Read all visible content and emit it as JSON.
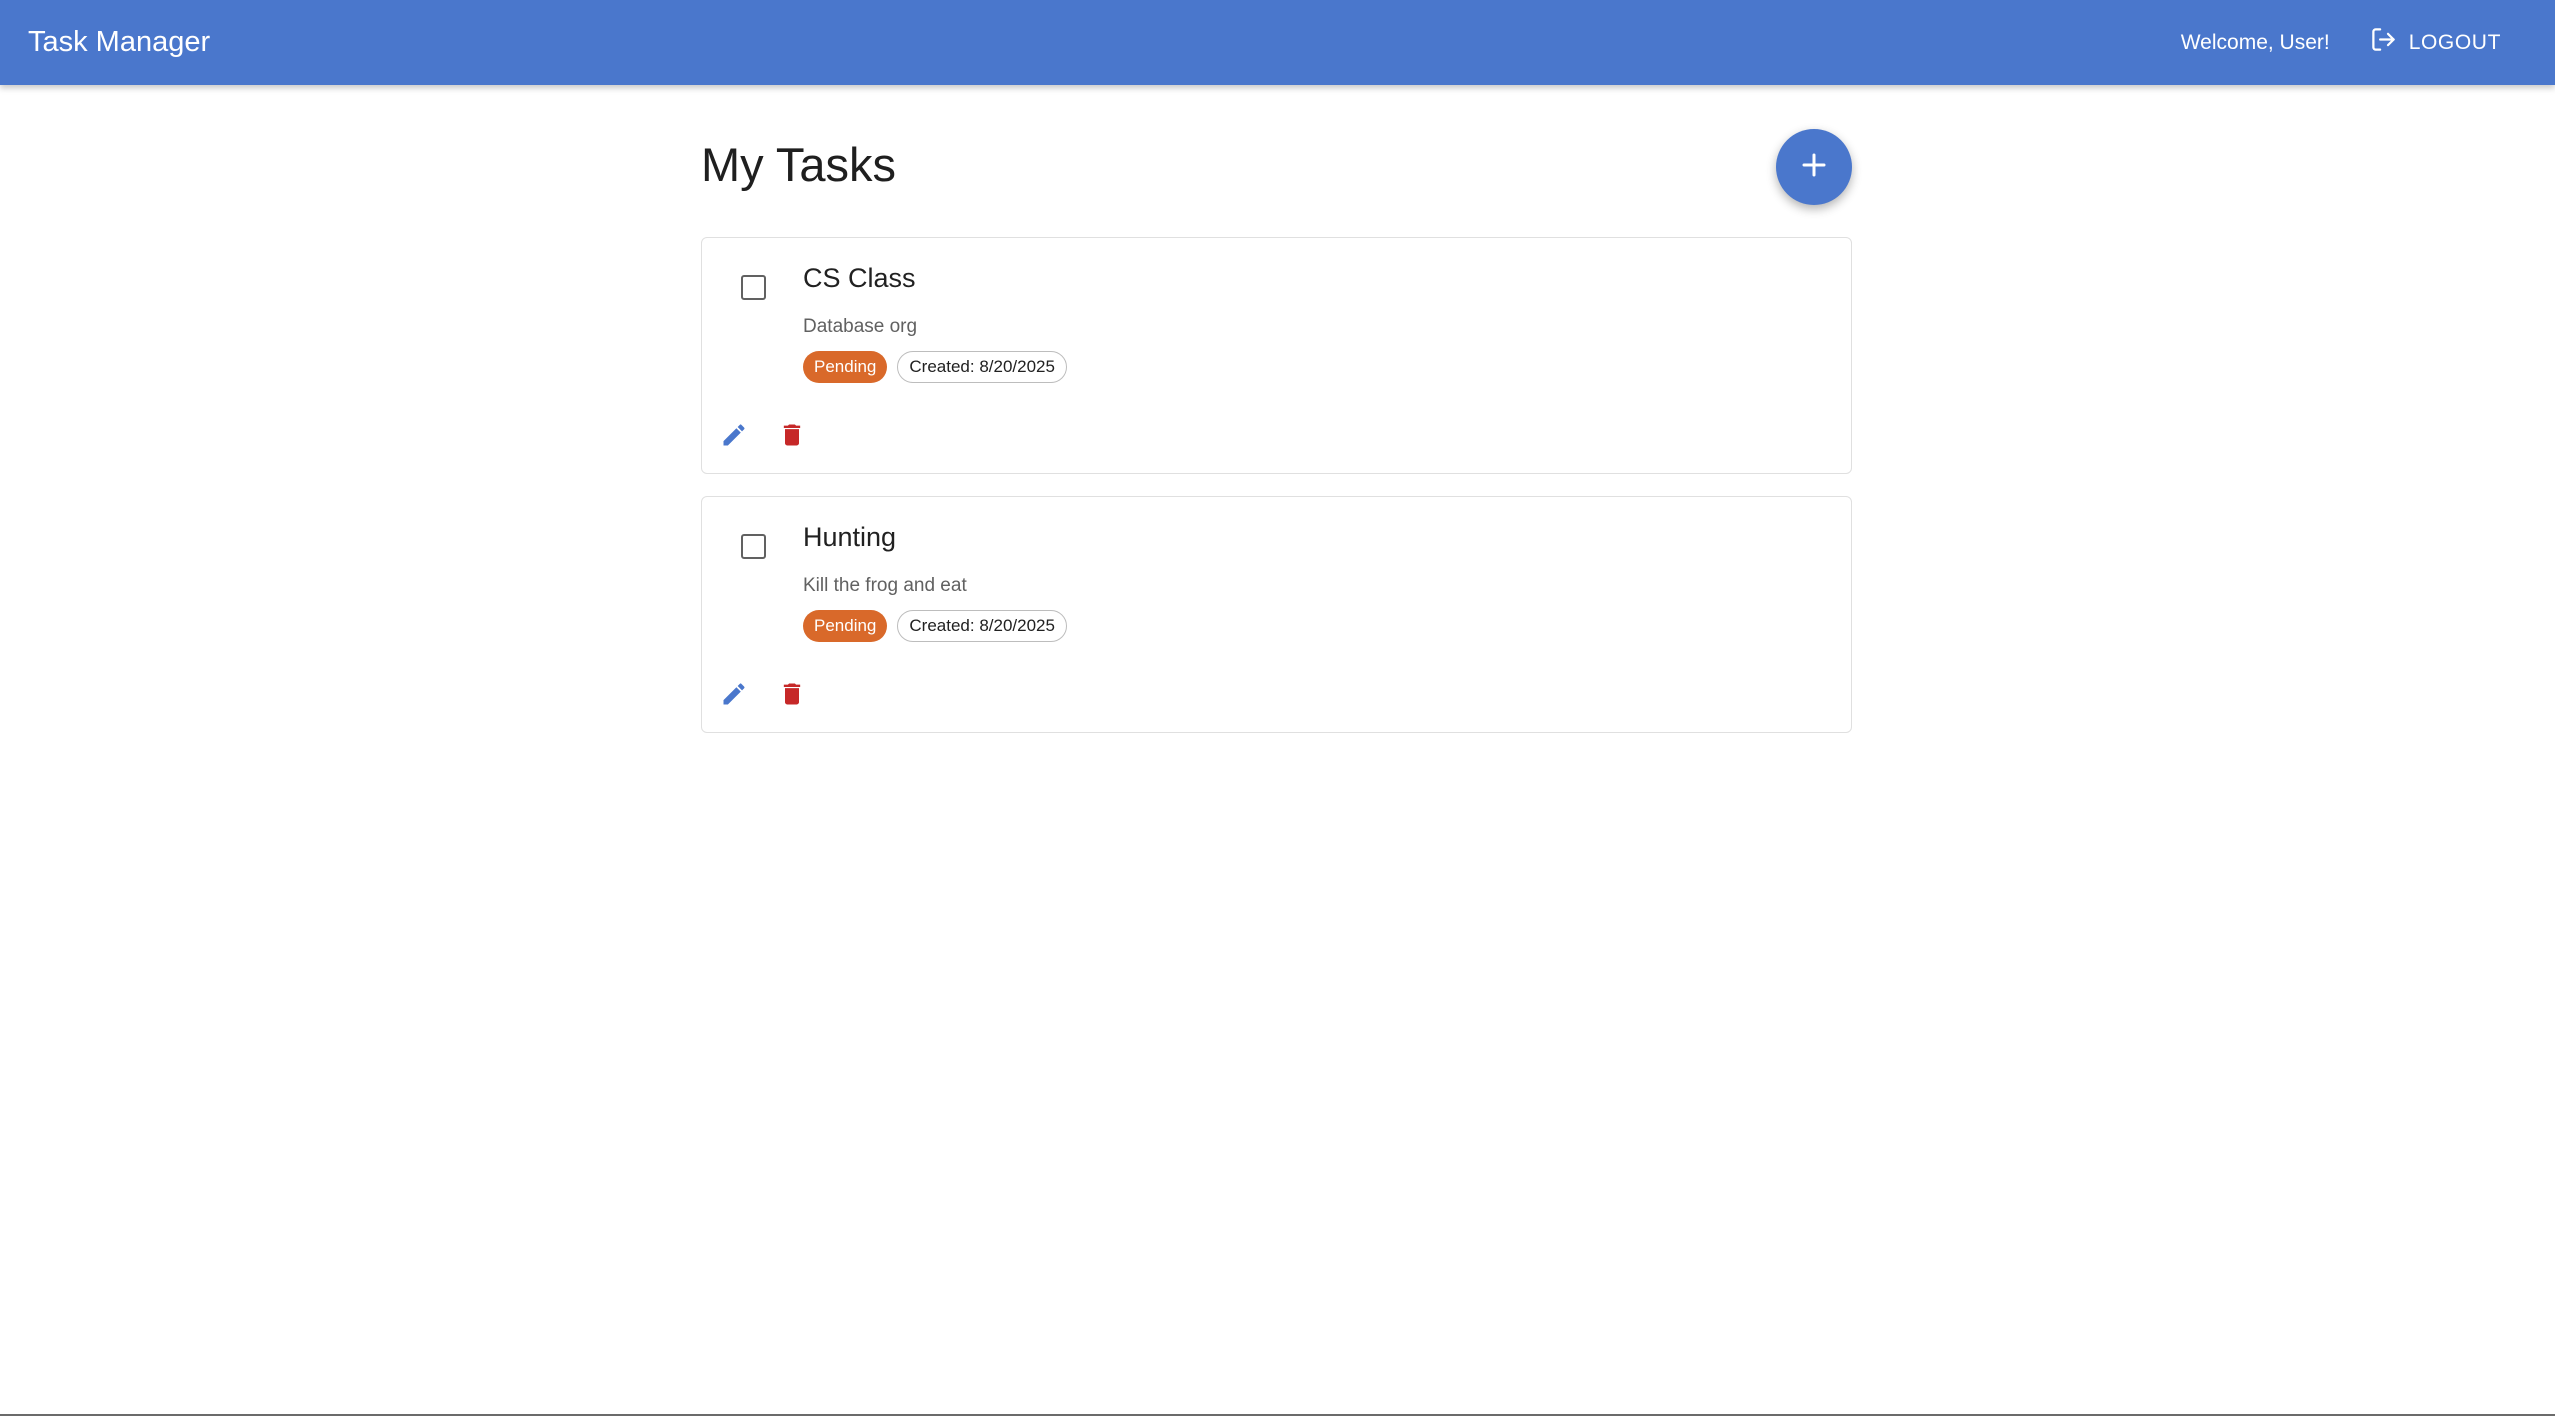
{
  "header": {
    "title": "Task Manager",
    "welcome": "Welcome, User!",
    "logout_label": "LOGOUT"
  },
  "main": {
    "title": "My Tasks",
    "add_icon": "plus-icon"
  },
  "tasks": [
    {
      "title": "CS Class",
      "description": "Database org",
      "status": "Pending",
      "created": "Created: 8/20/2025",
      "checked": false
    },
    {
      "title": "Hunting",
      "description": "Kill the frog and eat",
      "status": "Pending",
      "created": "Created: 8/20/2025",
      "checked": false
    }
  ],
  "colors": {
    "primary": "#4a77cc",
    "pending": "#d9692a",
    "delete": "#c62828"
  }
}
